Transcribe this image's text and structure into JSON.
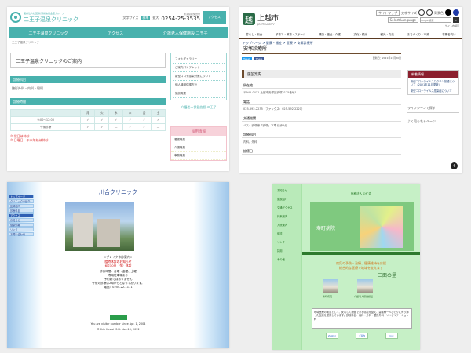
{
  "p1": {
    "logo_sub": "医療法人社団 新潟県信用金庫グループ",
    "logo_name": "二王子温泉クリニック",
    "header_links": [
      "文字サイズ",
      "標準",
      "拡大"
    ],
    "phone": "0254-25-3535",
    "phone_note": "新潟県新発田市",
    "access_btn": "アクセス",
    "nav": [
      "二王子温泉クリニック",
      "アクセス",
      "介護老人保健施設 二王子"
    ],
    "breadcrumb": "二王子温泉クリニック",
    "page_title": "二王子温泉クリニックのご案内",
    "section_dept": "診療科目",
    "dept_text": "整形外科・内科・眼科",
    "section_hours": "診療時間",
    "table_days": [
      "",
      "月",
      "火",
      "水",
      "木",
      "金",
      "土"
    ],
    "table_rows": [
      [
        "9:00～12:00",
        "✓",
        "✓",
        "✓",
        "✓",
        "✓",
        "✓"
      ],
      [
        "午後診療",
        "✓",
        "✓",
        "—",
        "✓",
        "✓",
        "—"
      ]
    ],
    "notes": [
      "※ 祝日は休診",
      "※ 日曜日・年末年始は休診"
    ],
    "menu": [
      "フォトギャラリー",
      "ご案内パンフレット",
      "新型コロナ感染対策について",
      "個人情報保護方針",
      "施設概要"
    ],
    "side_caption": "介護老人保健施設 二王子",
    "rec_title": "採用情報",
    "rec_items": [
      "看護職員",
      "介護職員",
      "事務職員"
    ]
  },
  "p2": {
    "city_name": "上越市",
    "city_en": "JOETSU CITY",
    "top_links": [
      "サイトマップ",
      "文字サイズ",
      "背景色"
    ],
    "search_placeholder": "サイト内検索",
    "search_engine": "Google 検索",
    "lang": "Select Language",
    "nav": [
      "暮らし・安全",
      "子育て・教育・スポーツ",
      "健康・福祉・介護",
      "文化・観光",
      "観光・文化",
      "まちづくり・市政",
      "事業者向け"
    ],
    "breadcrumb": "トップページ > 健康・福祉 > 医療 > 安塚診療所",
    "page_title": "安塚診療所",
    "updated": "更新日：2021年11月30日",
    "h_intro": "施設案内",
    "h_addr": "所在地",
    "addr": "〒942-0411 上越市安塚区安塚2175番地1",
    "h_tel": "電話",
    "tel": "025-592-2235（ファックス：025-592-2221）",
    "h_access": "交通機関",
    "access": "バス：安塚線「安塚」下車 徒歩5分",
    "h_dept": "診療科目",
    "dept": "内科、外科",
    "h_hours": "診療日",
    "side_title": "新着情報",
    "side_items": [
      "新型コロナウイルスワクチン接種について（2021年11月更新）",
      "新型コロナウイルス感染症について"
    ],
    "social": [
      "ライフシーンで探す",
      "よく見られるページ"
    ]
  },
  "p3": {
    "title": "川合クリニック",
    "lnav": [
      "トップページ",
      "クリニックの紹介",
      "医師紹介",
      "診療科目",
      "アクセス",
      "お知らせ",
      "健康情報",
      "リンク",
      "お問い合わせ"
    ],
    "news_head": "＜ブレイク休診案内＞",
    "news_red": [
      "臨時休診のお知らせ",
      "6月10日（金）休診"
    ],
    "news_body": [
      "診療時間：月曜～金曜、土曜",
      "専用駐車場あり",
      "予約制ではありません"
    ],
    "news_extra": "午後の診療は2時からとなっております。",
    "tel": "電話：0254-22-1111",
    "counter": "You are visitor number since Apr. 1, 2004",
    "copyright": "©Shin Kawai M.D.  Nov.10, 2022"
  },
  "p4": {
    "lnav": [
      "お知らせ",
      "施設紹介",
      "交通アクセス",
      "外来案内",
      "入院案内",
      "健診",
      "リンク",
      "採用",
      "その他"
    ],
    "label": "医療法人 公仁会",
    "hero": "寿町病院",
    "orange": [
      "病気の予防・治療、健康維持を応援",
      "総合的な医療で地域を支えます"
    ],
    "big": "三面の里",
    "cap1": "寿町病院",
    "cap2": "介護老人保健施設",
    "info": "地域医療の拠点として、安心して療養できる環境を整え、患者様一人ひとりに寄り添った医療を提供しています。診療科目：内科・外科・整形外科・リハビリテーション科",
    "logos": [
      "Zephyr",
      "ご案内",
      "link"
    ]
  }
}
